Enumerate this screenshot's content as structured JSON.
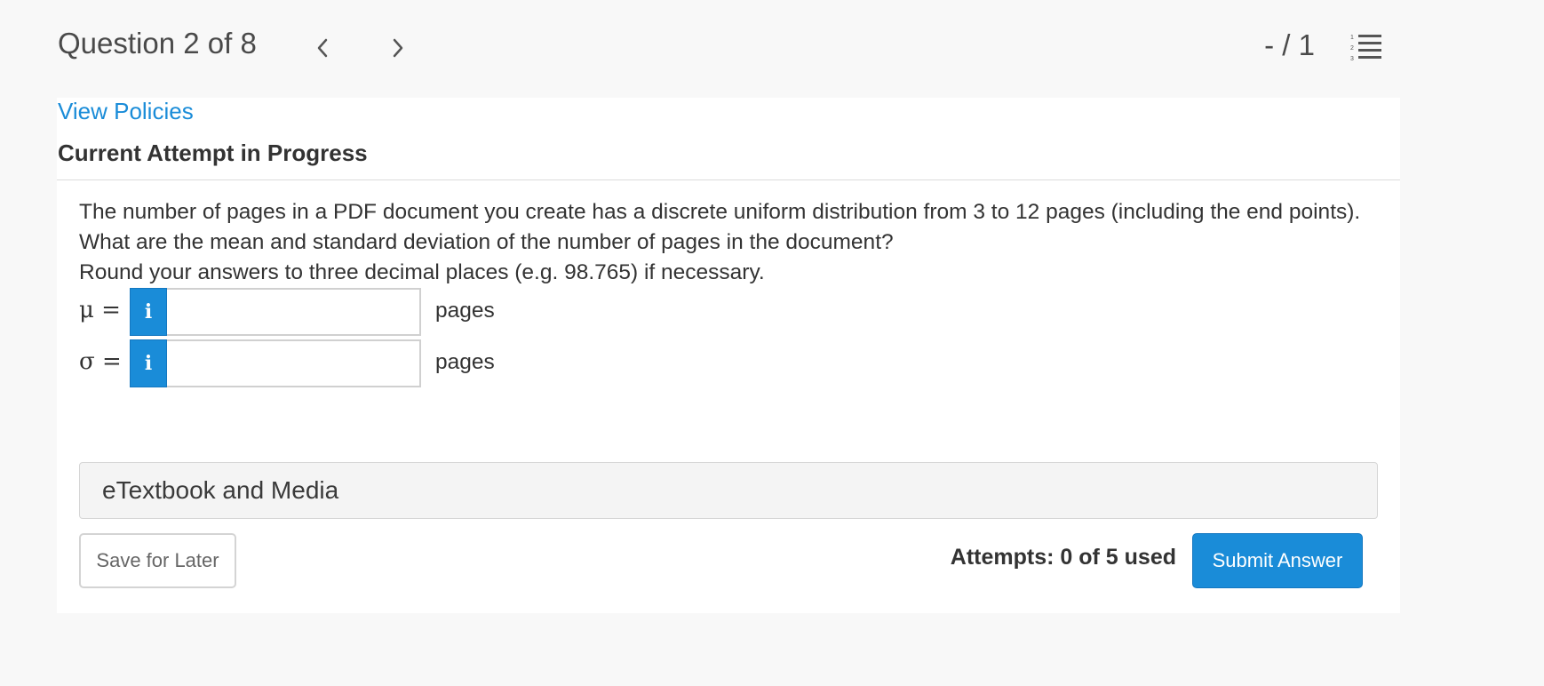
{
  "header": {
    "question_label": "Question 2 of 8",
    "score": "- / 1",
    "prev_icon": "chevron-left-icon",
    "next_icon": "chevron-right-icon",
    "question_list_icon": "numbered-list-icon"
  },
  "card": {
    "policies_link": "View Policies",
    "attempt_heading": "Current Attempt in Progress"
  },
  "question": {
    "lines": [
      "The number of pages in a PDF document you create has a discrete uniform distribution from 3 to 12 pages (including the end points).",
      "What are the mean and standard deviation of the number of pages in the document?",
      "Round your answers to three decimal places (e.g. 98.765) if necessary."
    ]
  },
  "answers": [
    {
      "label": "μ =",
      "info_glyph": "i",
      "value": "",
      "unit": "pages"
    },
    {
      "label": "σ =",
      "info_glyph": "i",
      "value": "",
      "unit": "pages"
    }
  ],
  "etextbook": {
    "label": "eTextbook and Media"
  },
  "footer": {
    "save_label": "Save for Later",
    "attempts_text": "Attempts: 0 of 5 used",
    "submit_label": "Submit Answer"
  },
  "colors": {
    "accent": "#1a8cd8",
    "background": "#f8f8f8",
    "card": "#ffffff",
    "text": "#333333"
  }
}
